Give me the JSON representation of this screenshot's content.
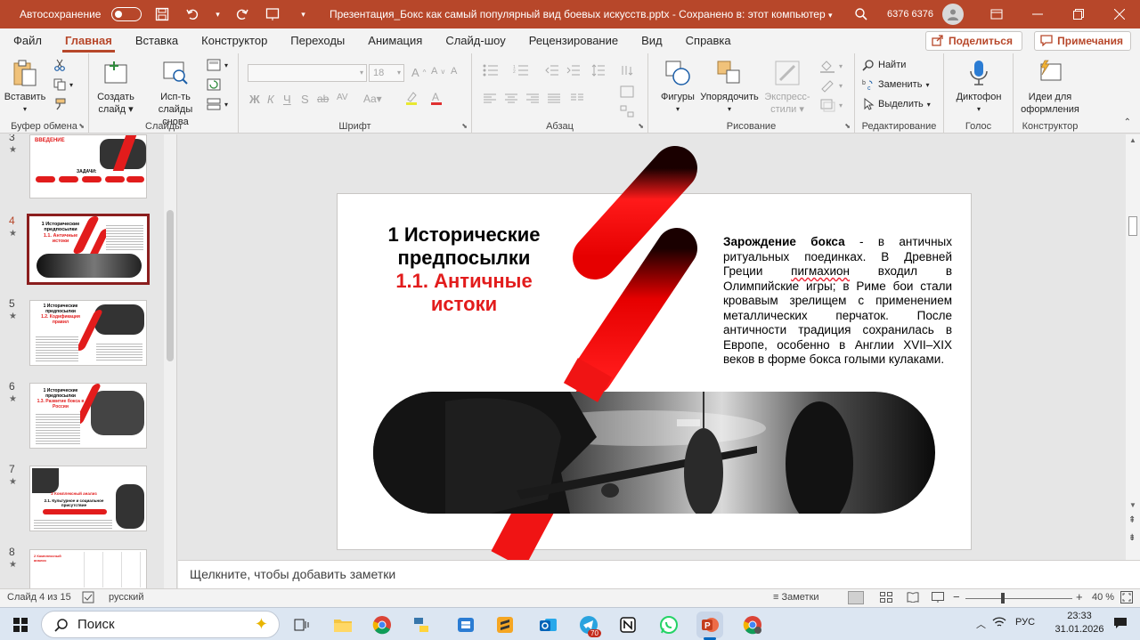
{
  "titlebar": {
    "autosave_label": "Автосохранение",
    "doc_title": "Презентация_Бокс как самый популярный вид боевых искусств.pptx",
    "save_status": "Сохранено в: этот компьютер",
    "user_name": "6376 6376"
  },
  "tabs": [
    "Файл",
    "Главная",
    "Вставка",
    "Конструктор",
    "Переходы",
    "Анимация",
    "Слайд-шоу",
    "Рецензирование",
    "Вид",
    "Справка"
  ],
  "share_label": "Поделиться",
  "comments_label": "Примечания",
  "ribbon": {
    "clipboard": {
      "paste": "Вставить",
      "group": "Буфер обмена"
    },
    "slides": {
      "new_slide_1": "Создать",
      "new_slide_2": "слайд",
      "reuse_1": "Исп-ть",
      "reuse_2": "слайды снова",
      "group": "Слайды"
    },
    "font": {
      "size": "18",
      "group": "Шрифт",
      "bold": "Ж",
      "italic": "К",
      "underline": "Ч",
      "strike": "S",
      "abc": "ab",
      "spacing": "AV"
    },
    "paragraph": {
      "group": "Абзац"
    },
    "drawing": {
      "shapes": "Фигуры",
      "arrange": "Упорядочить",
      "quick_styles_1": "Экспресс-",
      "quick_styles_2": "стили",
      "group": "Рисование"
    },
    "editing": {
      "find": "Найти",
      "replace": "Заменить",
      "select": "Выделить",
      "group": "Редактирование"
    },
    "voice": {
      "dictate": "Диктофон",
      "group": "Голос"
    },
    "designer": {
      "ideas_1": "Идеи для",
      "ideas_2": "оформления",
      "group": "Конструктор"
    }
  },
  "thumbnails": [
    {
      "num": "3",
      "title": "ВВЕДЕНИЕ",
      "sub": "ЗАДАЧИ:"
    },
    {
      "num": "4",
      "title": "1 Исторические предпосылки",
      "sub": "1.1. Античные истоки"
    },
    {
      "num": "5",
      "title": "1 Исторические предпосылки",
      "sub": "1.2. Кодификация правил"
    },
    {
      "num": "6",
      "title": "1 Исторические предпосылки",
      "sub": "1.3. Развитие бокса в России"
    },
    {
      "num": "7",
      "title": "2 Комплексный анализ",
      "sub": "2.1. Культурное и социальное присутствие"
    },
    {
      "num": "8",
      "title": "2 Комплексный анализ",
      "sub": ""
    }
  ],
  "slide": {
    "title_line1": "1 Исторические",
    "title_line2": "предпосылки",
    "subtitle_line1": "1.1. Античные",
    "subtitle_line2": "истоки",
    "body_bold": "Зарождение бокса",
    "body_p1": " - в античных ритуальных поединках. В Древней Греции ",
    "body_word": "пигмахион",
    "body_p2": " входил в Олимпийские игры; в Риме бои стали кровавым зрелищем с применением металлических перчаток. После античности традиция сохранилась в Европе, особенно в Англии XVII–XIX веков в форме бокса голыми кулаками."
  },
  "notes_placeholder": "Щелкните, чтобы добавить заметки",
  "status": {
    "slide_of": "Слайд 4 из 15",
    "language": "русский",
    "notes": "Заметки",
    "zoom": "40 %"
  },
  "taskbar": {
    "search": "Поиск",
    "language": "РУС",
    "time": "23:33",
    "date": "31.01.2026",
    "telegram_badge": "70"
  }
}
